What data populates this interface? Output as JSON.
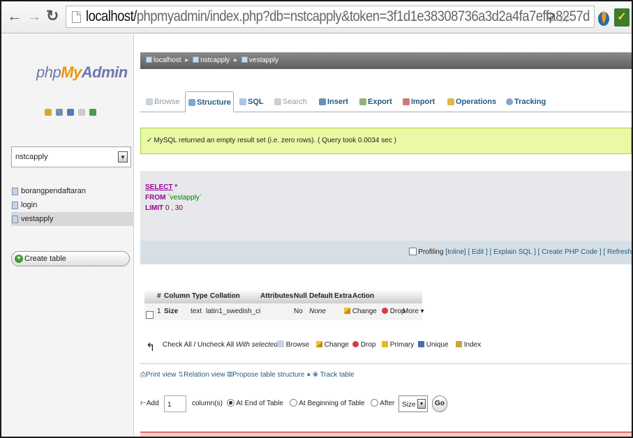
{
  "browser": {
    "url_host": "localhost/",
    "url_path": "phpmyadmin/index.php?db=nstcapply&token=3f1d1e38308736a3d2a4fa7effa8257d"
  },
  "left_pane": {
    "logo": {
      "php": "php",
      "my": "My",
      "admin": "Admin"
    },
    "db_selected": "nstcapply",
    "tables": [
      "borangpendaftaran",
      "login",
      "vestapply"
    ],
    "selected_table_index": 2,
    "create_table_label": "Create table"
  },
  "breadcrumb": {
    "server": "localhost",
    "database": "nstcapply",
    "table": "vestapply"
  },
  "tabs": [
    {
      "label": "Browse",
      "state": "disabled"
    },
    {
      "label": "Structure",
      "state": "active"
    },
    {
      "label": "SQL",
      "state": "normal"
    },
    {
      "label": "Search",
      "state": "disabled"
    },
    {
      "label": "Insert",
      "state": "normal"
    },
    {
      "label": "Export",
      "state": "normal"
    },
    {
      "label": "Import",
      "state": "normal"
    },
    {
      "label": "Operations",
      "state": "normal"
    },
    {
      "label": "Tracking",
      "state": "normal"
    }
  ],
  "message": "MySQL returned an empty result set (i.e. zero rows). ( Query took 0.0034 sec )",
  "sql": {
    "select_kw": "SELECT",
    "select_rest": " *",
    "from_kw": "FROM",
    "from_rest": " `vestapply`",
    "limit_kw": "LIMIT",
    "limit_rest": " 0 , 30"
  },
  "profiling": {
    "label": "Profiling",
    "links": "[Inline] [ Edit ] [ Explain SQL ] [ Create PHP Code ] [ Refresh"
  },
  "structure": {
    "headers": [
      "#",
      "Column",
      "Type",
      "Collation",
      "Attributes",
      "Null",
      "Default",
      "Extra",
      "Action"
    ],
    "row": {
      "num": "1",
      "column": "Size",
      "type": "text",
      "collation": "latin1_swedish_ci",
      "null": "No",
      "default": "None",
      "change": "Change",
      "drop": "Drop",
      "more": "More ▾"
    }
  },
  "check_all": {
    "label": "Check All / Uncheck All",
    "with_selected": "With selected:",
    "actions": [
      "Browse",
      "Change",
      "Drop",
      "Primary",
      "Unique",
      "Index"
    ]
  },
  "bottom_links": {
    "print_view": "Print view",
    "relation_view": "Relation view",
    "propose": "Propose table structure",
    "track": "Track table"
  },
  "add_columns": {
    "add_label": "Add",
    "count": "1",
    "columns_label": "column(s)",
    "at_end": "At End of Table",
    "at_beginning": "At Beginning of Table",
    "after": "After",
    "after_select": "Size",
    "go": "Go"
  }
}
